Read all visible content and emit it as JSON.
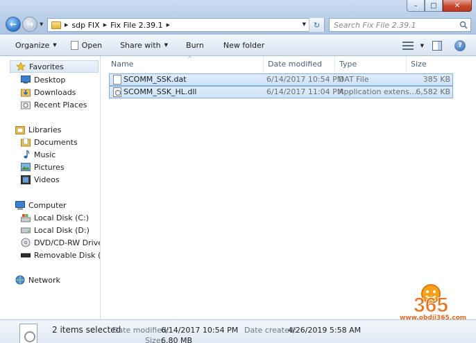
{
  "address": {
    "crumbs": [
      "sdp FIX",
      "Fix File 2.39.1"
    ]
  },
  "search": {
    "placeholder": "Search Fix File 2.39.1"
  },
  "toolbar": {
    "organize": "Organize",
    "open": "Open",
    "share_with": "Share with",
    "burn": "Burn",
    "new_folder": "New folder"
  },
  "nav": {
    "favorites": {
      "label": "Favorites",
      "items": [
        "Desktop",
        "Downloads",
        "Recent Places"
      ]
    },
    "libraries": {
      "label": "Libraries",
      "items": [
        "Documents",
        "Music",
        "Pictures",
        "Videos"
      ]
    },
    "computer": {
      "label": "Computer",
      "items": [
        "Local Disk (C:)",
        "Local Disk (D:)",
        "DVD/CD-RW Drive (I",
        "Removable Disk (F:)"
      ]
    },
    "network": {
      "label": "Network"
    }
  },
  "columns": {
    "name": "Name",
    "date": "Date modified",
    "type": "Type",
    "size": "Size"
  },
  "files": [
    {
      "name": "SCOMM_SSK.dat",
      "date": "6/14/2017 10:54 PM",
      "type": "DAT File",
      "size": "385 KB"
    },
    {
      "name": "SCOMM_SSK_HL.dll",
      "date": "6/14/2017 11:04 PM",
      "type": "Application extens...",
      "size": "6,582 KB"
    }
  ],
  "details": {
    "selected": "2 items selected",
    "modified_label": "Date modified:",
    "modified_value": "6/14/2017 10:54 PM",
    "created_label": "Date created:",
    "created_value": "4/26/2019 5:58 AM",
    "size_label": "Size:",
    "size_value": "6.80 MB"
  },
  "watermark": {
    "logo": "365",
    "url": "www.obdii365.com"
  },
  "colors": {
    "accent": "#2e74c8",
    "watermark": "#e06a1d"
  }
}
